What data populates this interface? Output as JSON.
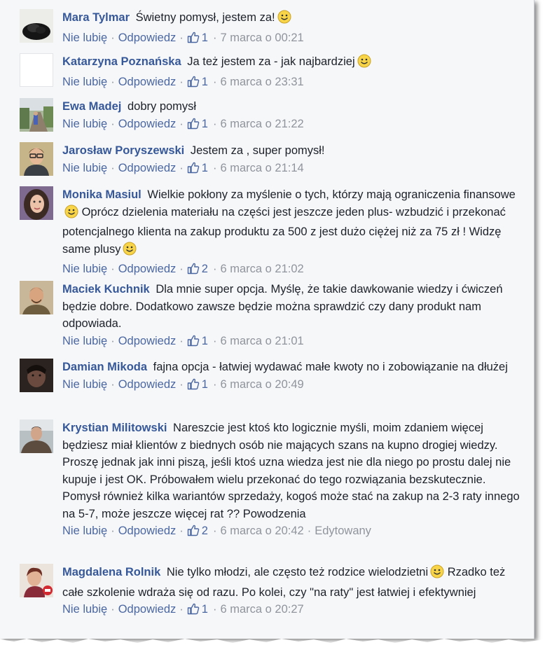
{
  "actions": {
    "unlike": "Nie lubię",
    "reply": "Odpowiedz"
  },
  "accent": "#365899",
  "comments": [
    {
      "author": "Mara Tylmar",
      "text": "Świetny pomysł, jestem za!",
      "smiley": true,
      "likes": "1",
      "time": "7 marca o 00:21",
      "edited": ""
    },
    {
      "author": "Katarzyna Poznańska",
      "text": "Ja też jestem za - jak najbardziej",
      "smiley": true,
      "likes": "1",
      "time": "6 marca o 23:31",
      "edited": ""
    },
    {
      "author": "Ewa Madej",
      "text": "dobry pomysł",
      "smiley": false,
      "likes": "1",
      "time": "6 marca o 21:22",
      "edited": ""
    },
    {
      "author": "Jarosław Poryszewski",
      "text": "Jestem za , super pomysł!",
      "smiley": false,
      "likes": "1",
      "time": "6 marca o 21:14",
      "edited": ""
    },
    {
      "author": "Monika Masiul",
      "text_a": "Wielkie pokłony za myślenie o tych, którzy mają ograniczenia finansowe",
      "text_b": "Oprócz dzielenia materiału na części jest jeszcze jeden plus- wzbudzić i przekonać potencjalnego klienta na zakup produktu za 500 z jest dużo ciężej niż za 75 zł ! Widzę same plusy",
      "likes": "2",
      "time": "6 marca o 21:02",
      "edited": ""
    },
    {
      "author": "Maciek Kuchnik",
      "text": "Dla mnie super opcja. Myślę, że takie dawkowanie wiedzy i ćwiczeń będzie dobre. Dodatkowo zawsze będzie można sprawdzić czy dany produkt nam odpowiada.",
      "smiley": false,
      "likes": "1",
      "time": "6 marca o 21:01",
      "edited": ""
    },
    {
      "author": "Damian Mikoda",
      "text": "fajna opcja - łatwiej wydawać małe kwoty no i zobowiązanie na dłużej",
      "smiley": false,
      "likes": "1",
      "time": "6 marca o 20:49",
      "edited": ""
    },
    {
      "author": "Krystian Militowski",
      "text": "Nareszcie jest ktoś kto logicznie myśli, moim zdaniem więcej będziesz miał klientów z biednych osób nie mających szans na kupno drogiej wiedzy. Proszę jednak jak inni piszą, jeśli ktoś uzna wiedza jest nie dla niego po prostu dalej nie kupuje i jest OK. Próbowałem wielu przekonać do tego rozwiązania bezskutecznie. Pomysł również kilka wariantów sprzedaży, kogoś może stać na zakup na 2-3 raty innego na 5-7, może jeszcze więcej rat ?? Powodzenia",
      "smiley": false,
      "likes": "2",
      "time": "6 marca o 20:42",
      "edited": "Edytowany"
    },
    {
      "author": "Magdalena Rolnik",
      "text_a": "Nie tylko młodzi, ale często też rodzice wielodzietni",
      "text_b": "Rzadko też całe szkolenie wdraża się od razu. Po kolei, czy \"na raty\" jest łatwiej i efektywniej",
      "likes": "1",
      "time": "6 marca o 20:27",
      "edited": ""
    }
  ]
}
